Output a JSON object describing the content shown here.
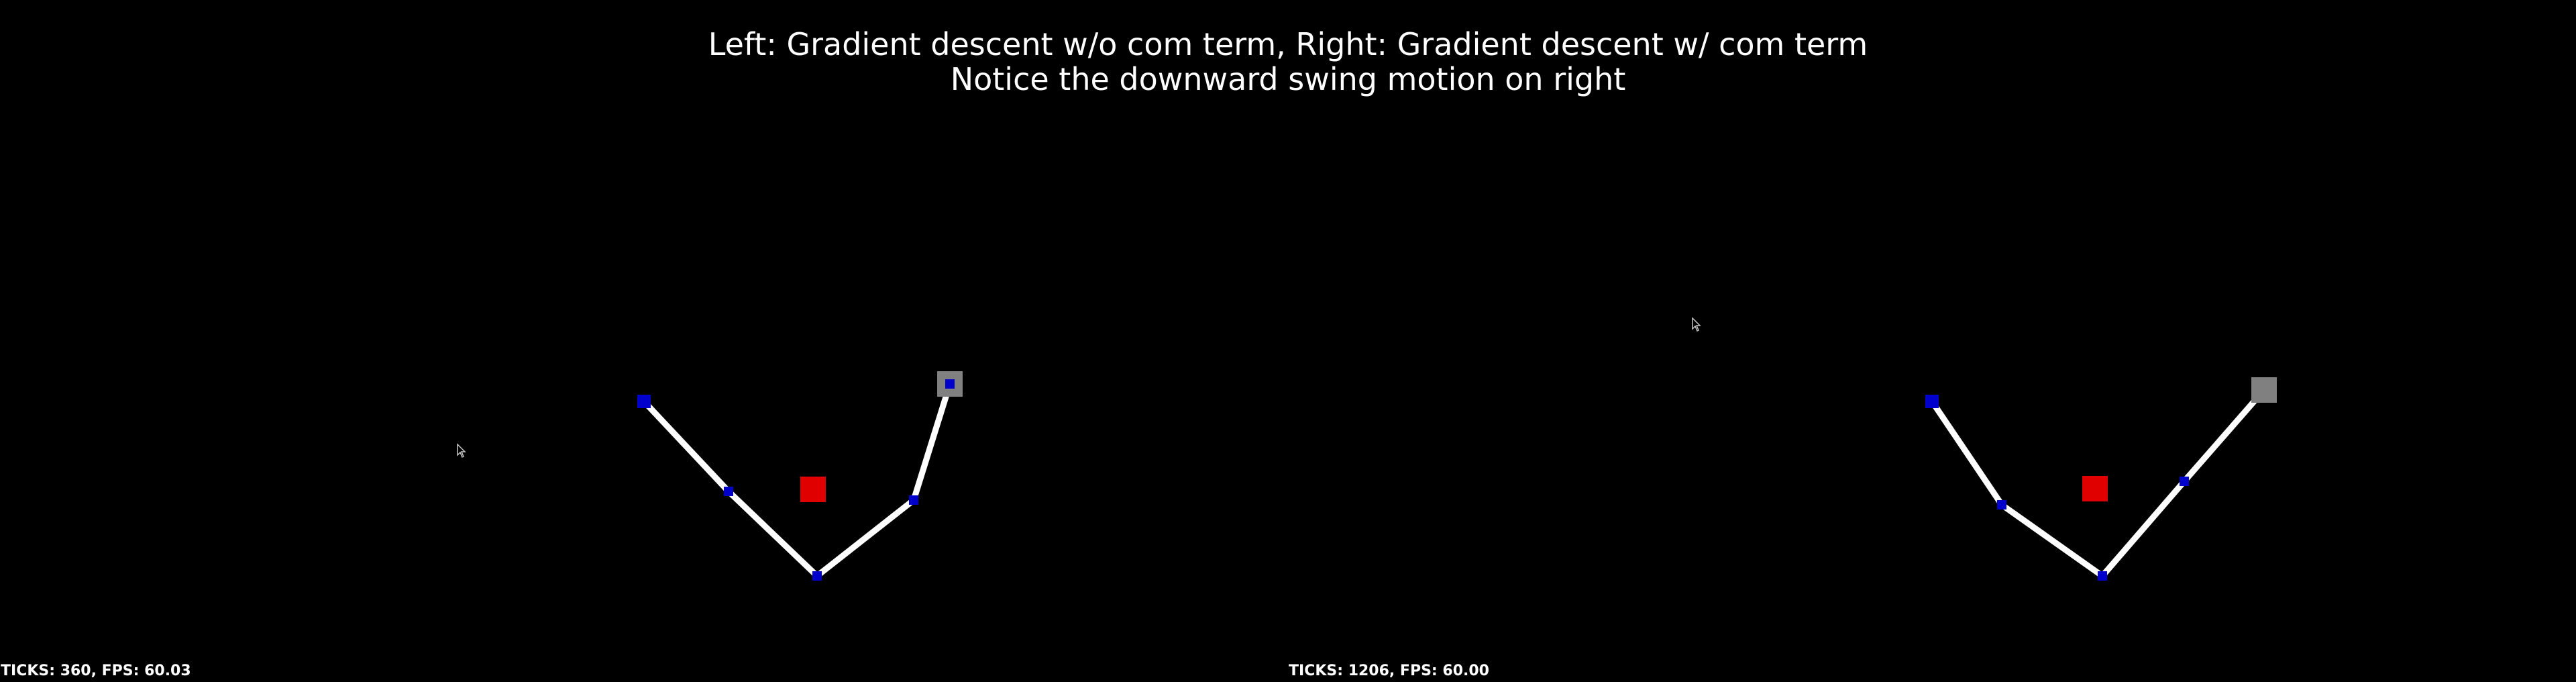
{
  "title": {
    "line1": "Left: Gradient descent w/o com term, Right: Gradient descent w/ com term",
    "line2": "Notice the downward swing motion on right"
  },
  "left_panel": {
    "status": "TICKS: 360, FPS: 60.03"
  },
  "right_panel": {
    "status": "TICKS: 1206, FPS: 60.00"
  },
  "colors": {
    "background": "#000000",
    "link": "#ffffff",
    "joint": "#0000cc",
    "center_of_mass": "#e00000",
    "target": "#808080"
  },
  "icons": {
    "cursor": "mouse-cursor-icon"
  }
}
